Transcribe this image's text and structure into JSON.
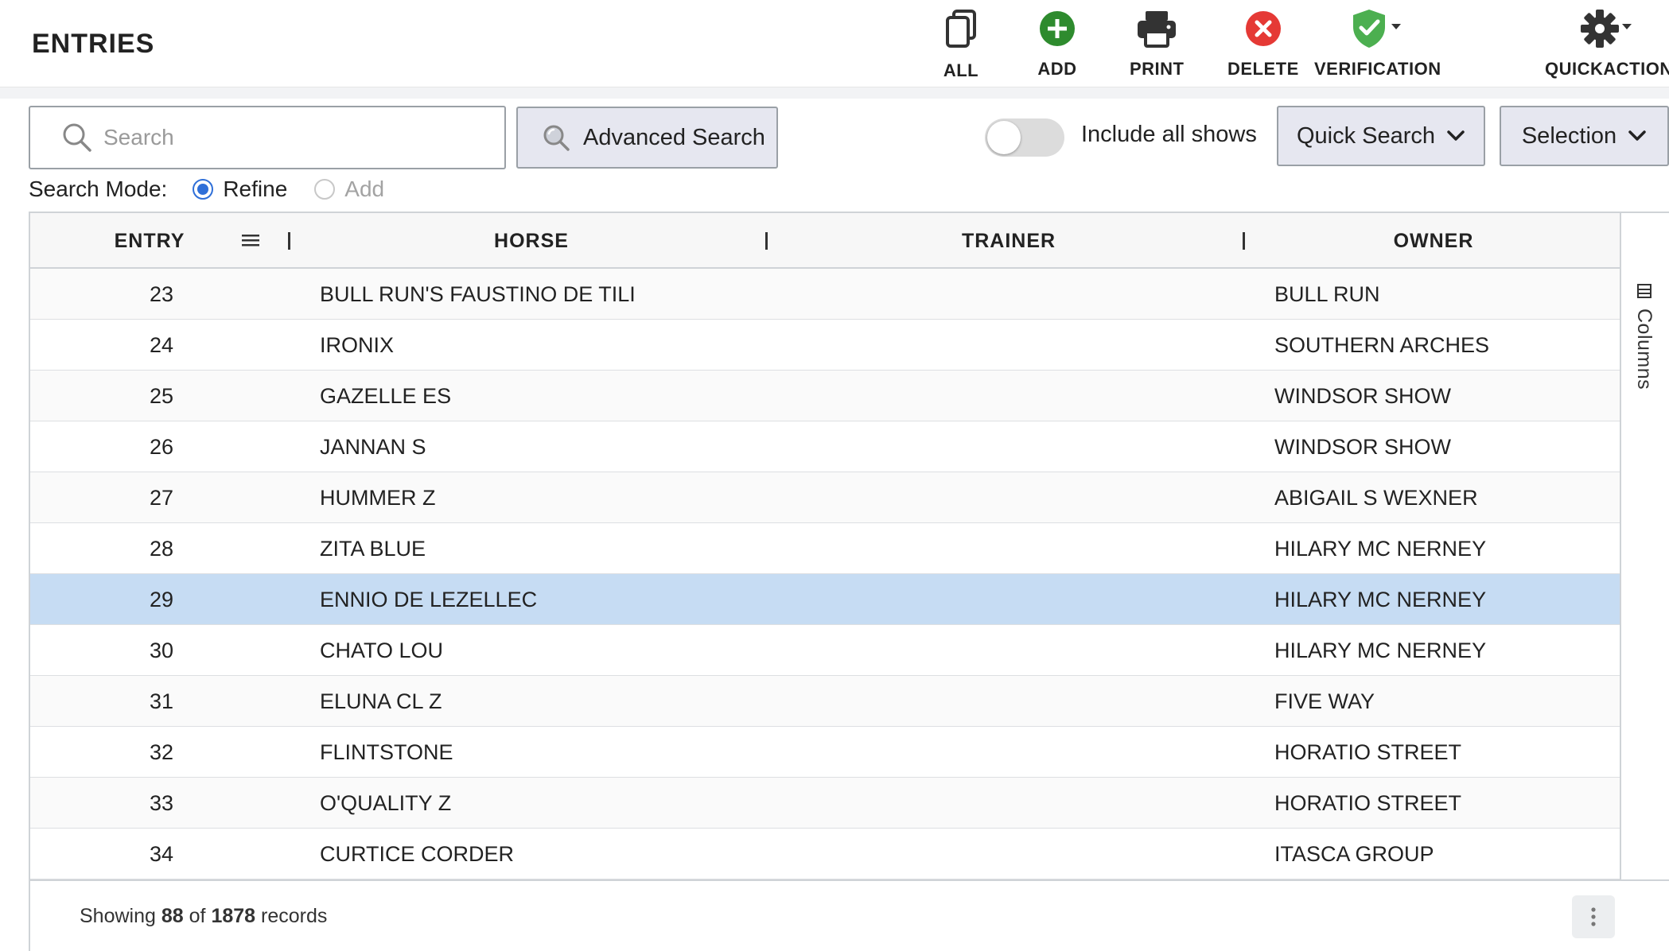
{
  "header": {
    "title": "ENTRIES",
    "tools": [
      {
        "label": "ALL",
        "icon": "copy-icon"
      },
      {
        "label": "ADD",
        "icon": "add-circle-icon"
      },
      {
        "label": "PRINT",
        "icon": "printer-icon"
      },
      {
        "label": "DELETE",
        "icon": "delete-circle-icon"
      },
      {
        "label": "VERIFICATION",
        "icon": "shield-check-icon"
      },
      {
        "label": "QUICKACTION",
        "icon": "gear-icon"
      }
    ]
  },
  "search": {
    "placeholder": "Search",
    "advanced_label": "Advanced Search",
    "include_all_shows_label": "Include all shows",
    "include_all_shows_on": false,
    "quick_search_label": "Quick Search",
    "selection_label": "Selection",
    "mode_label": "Search Mode:",
    "mode_options": [
      "Refine",
      "Add"
    ],
    "mode_selected": "Refine"
  },
  "grid": {
    "columns": [
      "ENTRY",
      "HORSE",
      "TRAINER",
      "OWNER"
    ],
    "rows": [
      {
        "entry": "23",
        "horse": "BULL RUN'S FAUSTINO DE TILI",
        "trainer": "",
        "owner": "BULL RUN"
      },
      {
        "entry": "24",
        "horse": "IRONIX",
        "trainer": "",
        "owner": "SOUTHERN ARCHES"
      },
      {
        "entry": "25",
        "horse": "GAZELLE ES",
        "trainer": "",
        "owner": "WINDSOR SHOW"
      },
      {
        "entry": "26",
        "horse": "JANNAN S",
        "trainer": "",
        "owner": "WINDSOR SHOW"
      },
      {
        "entry": "27",
        "horse": "HUMMER Z",
        "trainer": "",
        "owner": "ABIGAIL S WEXNER"
      },
      {
        "entry": "28",
        "horse": "ZITA BLUE",
        "trainer": "",
        "owner": "HILARY MC NERNEY"
      },
      {
        "entry": "29",
        "horse": "ENNIO DE LEZELLEC",
        "trainer": "",
        "owner": "HILARY MC NERNEY",
        "selected": true
      },
      {
        "entry": "30",
        "horse": "CHATO LOU",
        "trainer": "",
        "owner": "HILARY MC NERNEY"
      },
      {
        "entry": "31",
        "horse": "ELUNA CL Z",
        "trainer": "",
        "owner": "FIVE WAY"
      },
      {
        "entry": "32",
        "horse": "FLINTSTONE",
        "trainer": "",
        "owner": "HORATIO STREET"
      },
      {
        "entry": "33",
        "horse": "O'QUALITY Z",
        "trainer": "",
        "owner": "HORATIO STREET"
      },
      {
        "entry": "34",
        "horse": "CURTICE CORDER",
        "trainer": "",
        "owner": "ITASCA GROUP"
      }
    ],
    "side_panel_label": "Columns",
    "footer": {
      "prefix": "Showing",
      "shown": "88",
      "of": "of",
      "total": "1878",
      "suffix": "records"
    }
  },
  "colors": {
    "add_green": "#2e8b2e",
    "delete_red": "#e53935",
    "verify_green": "#4caf50",
    "selected_row": "#c6dcf3",
    "radio_blue": "#2f6fd8",
    "button_bg": "#e6e7f0"
  }
}
